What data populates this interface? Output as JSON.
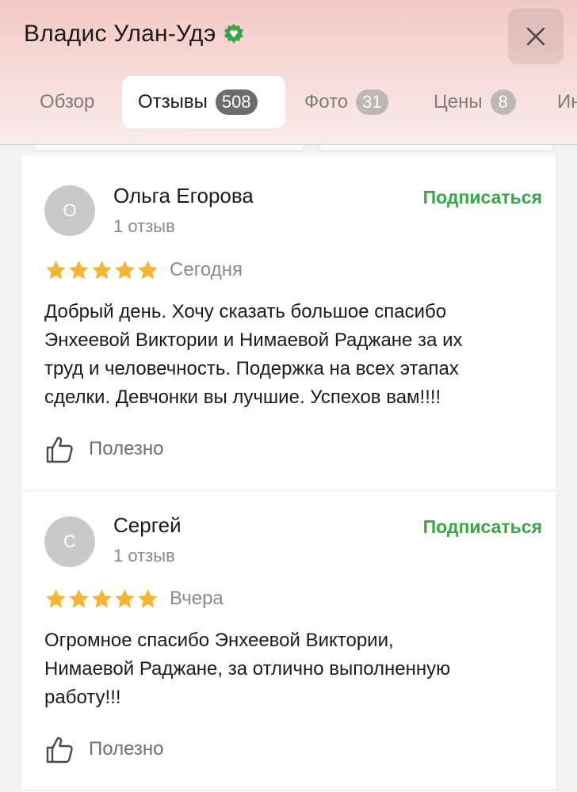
{
  "header": {
    "title": "Владис Улан-Удэ",
    "verified_icon": "verified-badge-icon",
    "close_icon": "close-icon"
  },
  "tabs": [
    {
      "label": "Обзор",
      "count": null,
      "active": false
    },
    {
      "label": "Отзывы",
      "count": "508",
      "active": true
    },
    {
      "label": "Фото",
      "count": "31",
      "active": false
    },
    {
      "label": "Цены",
      "count": "8",
      "active": false
    },
    {
      "label": "Ин",
      "count": null,
      "active": false
    }
  ],
  "reviews": [
    {
      "avatar_letter": "О",
      "author": "Ольга Егорова",
      "meta": "1 отзыв",
      "subscribe_label": "Подписаться",
      "rating": 5,
      "date": "Сегодня",
      "text": "Добрый день. Хочу сказать большое спасибо\nЭнхеевой Виктории и Нимаевой Раджане за их\nтруд и человечность. Подержка на всех этапах\nсделки. Девчонки вы лучшие. Успехов вам!!!!",
      "useful_label": "Полезно"
    },
    {
      "avatar_letter": "С",
      "author": "Сергей",
      "meta": "1 отзыв",
      "subscribe_label": "Подписаться",
      "rating": 5,
      "date": "Вчера",
      "text": "Огромное спасибо Энхеевой Виктории,\nНимаевой Раджане, за отлично выполненную\nработу!!!",
      "useful_label": "Полезно"
    }
  ],
  "colors": {
    "accent_green": "#3aa548",
    "star_color": "#f2b535",
    "header_tint": "#f4c9c7"
  }
}
